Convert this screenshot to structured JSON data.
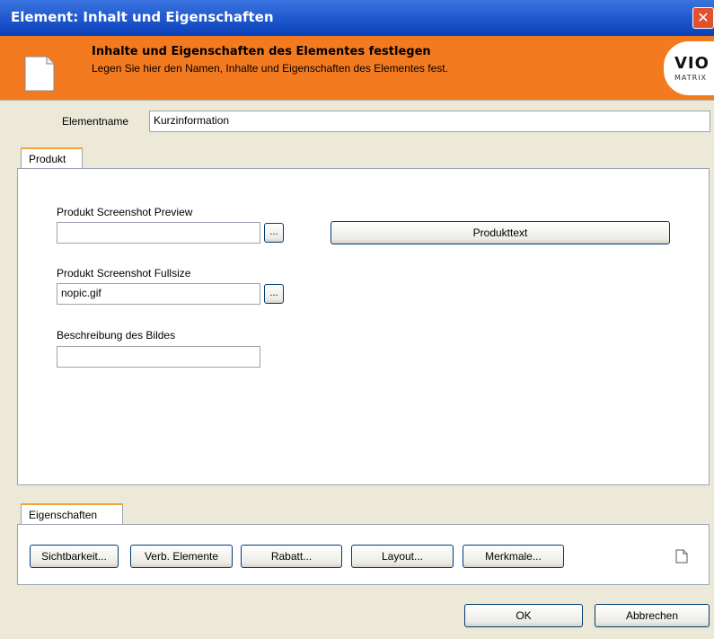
{
  "window": {
    "title": "Element: Inhalt und Eigenschaften",
    "close_glyph": "✕"
  },
  "header": {
    "title": "Inhalte und Eigenschaften des Elementes festlegen",
    "subtitle": "Legen Sie hier den Namen, Inhalte und Eigenschaften des Elementes fest.",
    "logo_top": "VIO",
    "logo_bottom": "MATRIX",
    "background_color": "#F47A20"
  },
  "element_name": {
    "label": "Elementname",
    "value": "Kurzinformation"
  },
  "product_tab": {
    "label": "Produkt",
    "preview": {
      "label": "Produkt Screenshot Preview",
      "value": "",
      "browse_label": "..."
    },
    "fullsize": {
      "label": "Produkt Screenshot Fullsize",
      "value": "nopic.gif",
      "browse_label": "..."
    },
    "description": {
      "label": "Beschreibung des Bildes",
      "value": ""
    },
    "product_text_button": "Produkttext"
  },
  "properties_tab": {
    "label": "Eigenschaften",
    "buttons": {
      "visibility": "Sichtbarkeit...",
      "linked_elements": "Verb. Elemente",
      "discount": "Rabatt...",
      "layout": "Layout...",
      "features": "Merkmale..."
    }
  },
  "dialog_buttons": {
    "ok": "OK",
    "cancel": "Abbrechen"
  }
}
